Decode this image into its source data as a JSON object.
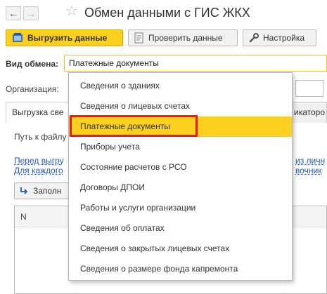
{
  "window": {
    "title": "Обмен данными с ГИС ЖКХ",
    "back_glyph": "←",
    "forward_glyph": "→",
    "star_glyph": "☆"
  },
  "toolbar": {
    "upload_label": "Выгрузить данные",
    "check_label": "Проверить данные",
    "settings_label": "Настройка"
  },
  "form": {
    "exchange_type_label": "Вид обмена:",
    "exchange_type_value": "Платежные документы",
    "organization_label": "Организация:"
  },
  "tabs": {
    "left_label": "Выгрузка све",
    "right_label": "икаторо"
  },
  "tab_content": {
    "path_label": "Путь к файлу",
    "link1_left": "Перед выгру",
    "link1_right": "из личн",
    "link2_left": "Для каждого",
    "link2_right": "вочник",
    "fill_button_label": "Заполн",
    "table_column_n": "N"
  },
  "dropdown": {
    "items": [
      "Сведения о зданиях",
      "Сведения о лицевых счетах",
      "Платежные документы",
      "Приборы учета",
      "Состояние расчетов с РСО",
      "Договоры ДПОИ",
      "Работы и услуги организации",
      "Сведения об оплатах",
      "Сведения о закрытых лицевых счетах",
      "Сведения о размере фонда капремонта"
    ],
    "selected_index": 2
  },
  "colors": {
    "accent_yellow": "#fbd01f",
    "highlight_red": "#e02020",
    "link_blue": "#2459b3"
  }
}
